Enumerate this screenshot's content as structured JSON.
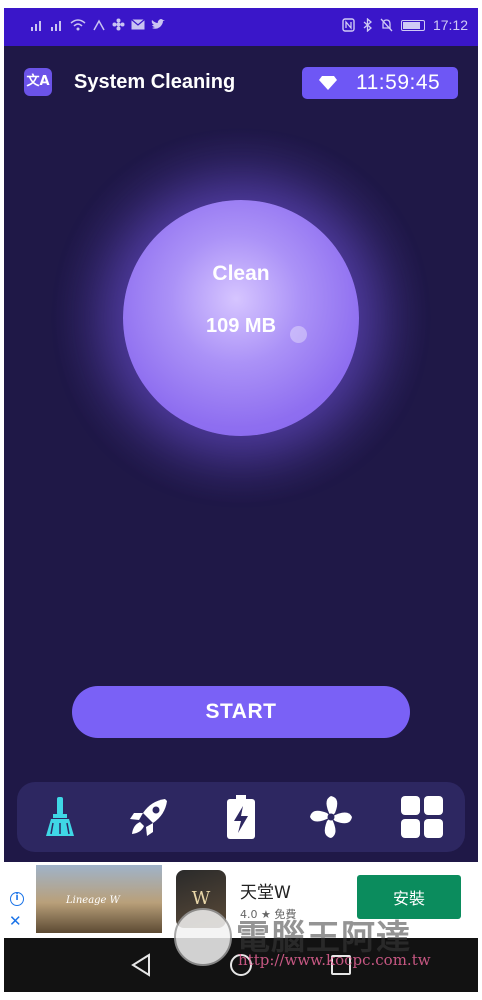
{
  "status_bar": {
    "left_icons": [
      "signal-icon",
      "signal-icon",
      "wifi-icon",
      "nfc-icon",
      "fan-icon",
      "mail-icon",
      "twitter-icon"
    ],
    "right_icons": [
      "nfc-icon",
      "bluetooth-icon",
      "mute-icon",
      "battery-icon"
    ],
    "time": "17:12"
  },
  "header": {
    "title": "System Cleaning",
    "translate_icon_glyph": "文A",
    "timer": "11:59:45",
    "timer_icon": "diamond-icon"
  },
  "orb": {
    "label": "Clean",
    "size": "109 MB"
  },
  "start_label": "START",
  "bottom_nav": {
    "items": [
      "broom-icon",
      "rocket-icon",
      "battery-charge-icon",
      "fan-icon",
      "grid-icon"
    ],
    "active_color": "#3fd7e6",
    "inactive_color": "#ffffff"
  },
  "ad": {
    "banner_text": "Lineage W",
    "app_icon_text": "W",
    "app_name": "天堂W",
    "rating": "4.0 ★  免費",
    "install_label": "安裝",
    "install_color": "#0b8c5d"
  },
  "watermark": {
    "text": "電腦王阿達",
    "url": "http://www.kocpc.com.tw"
  },
  "colors": {
    "background": "#1f1847",
    "accent": "#7a61f6",
    "status_bar": "#3a16c9"
  }
}
